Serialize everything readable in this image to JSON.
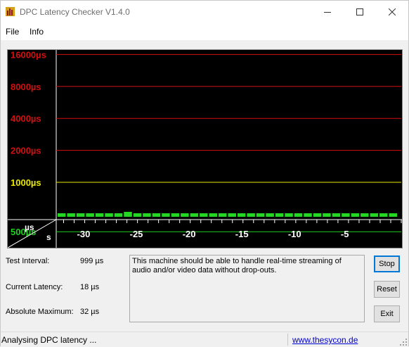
{
  "window": {
    "title": "DPC Latency Checker V1.4.0"
  },
  "menu": [
    {
      "label": "File"
    },
    {
      "label": "Info"
    }
  ],
  "graph": {
    "y_unit": "µs",
    "x_unit": "s",
    "y_ticks": [
      {
        "label": "16000µs",
        "value": 16000,
        "color": "#d01010"
      },
      {
        "label": "8000µs",
        "value": 8000,
        "color": "#d01010"
      },
      {
        "label": "4000µs",
        "value": 4000,
        "color": "#d01010"
      },
      {
        "label": "2000µs",
        "value": 2000,
        "color": "#d01010"
      },
      {
        "label": "1000µs",
        "value": 1000,
        "color": "#e8e800"
      },
      {
        "label": "500µs",
        "value": 500,
        "color": "#20d020"
      }
    ],
    "x_ticks": [
      {
        "label": "-30",
        "value": -30
      },
      {
        "label": "-25",
        "value": -25
      },
      {
        "label": "-20",
        "value": -20
      },
      {
        "label": "-15",
        "value": -15
      },
      {
        "label": "-10",
        "value": -10
      },
      {
        "label": "-5",
        "value": -5
      }
    ],
    "bar_color": "#22d822",
    "samples": [
      18,
      18,
      18,
      18,
      18,
      18,
      18,
      32,
      18,
      18,
      18,
      18,
      18,
      18,
      18,
      18,
      18,
      18,
      18,
      18,
      18,
      18,
      18,
      18,
      18,
      18,
      18,
      18,
      18,
      18,
      18,
      18,
      18,
      18,
      18,
      18
    ]
  },
  "stats": {
    "test_interval_label": "Test Interval:",
    "test_interval_value": "999 µs",
    "current_latency_label": "Current Latency:",
    "current_latency_value": "18 µs",
    "absolute_max_label": "Absolute Maximum:",
    "absolute_max_value": "32 µs"
  },
  "message": "This machine should be able to handle real-time streaming of audio and/or video data without drop-outs.",
  "buttons": {
    "stop": "Stop",
    "reset": "Reset",
    "exit": "Exit"
  },
  "status": {
    "text": "Analysing DPC latency ...",
    "link": "www.thesycon.de"
  }
}
